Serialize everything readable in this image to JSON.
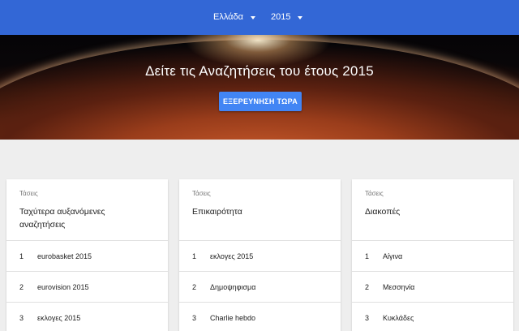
{
  "header": {
    "country": "Ελλάδα",
    "year": "2015"
  },
  "hero": {
    "title": "Δείτε τις Αναζητήσεις του έτους 2015",
    "button_label": "ΕΞΕΡΕΥΝΗΣΗ ΤΩΡΑ"
  },
  "cards": [
    {
      "kicker": "Τάσεις",
      "title": "Ταχύτερα αυξανόμενες αναζητήσεις",
      "items": [
        {
          "rank": "1",
          "label": "eurobasket 2015"
        },
        {
          "rank": "2",
          "label": "eurovision 2015"
        },
        {
          "rank": "3",
          "label": "εκλογες 2015"
        }
      ]
    },
    {
      "kicker": "Τάσεις",
      "title": "Επικαιρότητα",
      "items": [
        {
          "rank": "1",
          "label": "εκλογες 2015"
        },
        {
          "rank": "2",
          "label": "Δημοψηφισμα"
        },
        {
          "rank": "3",
          "label": "Charlie hebdo"
        }
      ]
    },
    {
      "kicker": "Τάσεις",
      "title": "Διακοπές",
      "items": [
        {
          "rank": "1",
          "label": "Αίγινα"
        },
        {
          "rank": "2",
          "label": "Μεσσηνία"
        },
        {
          "rank": "3",
          "label": "Κυκλάδες"
        }
      ]
    }
  ]
}
